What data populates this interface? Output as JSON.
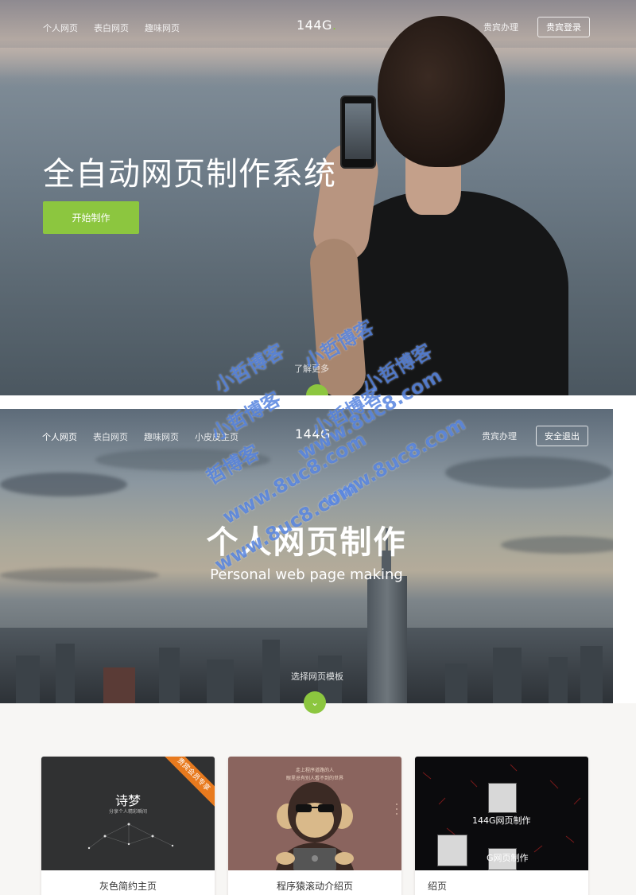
{
  "section1": {
    "nav": {
      "links": [
        "个人网页",
        "表白网页",
        "趣味网页"
      ],
      "brand": "144G",
      "brand_dot": ".",
      "vip": "贵宾办理",
      "login": "贵宾登录"
    },
    "title": "全自动网页制作系统",
    "cta": "开始制作",
    "learn_more": "了解更多",
    "scroll_icon": "chevron-down-icon"
  },
  "section2": {
    "nav": {
      "links": [
        "个人网页",
        "表白网页",
        "趣味网页",
        "小皮皮主页"
      ],
      "active_index": 0,
      "brand": "144G",
      "vip": "贵宾办理",
      "logout": "安全退出"
    },
    "title": "个人网页制作",
    "subtitle": "Personal web page making",
    "choose": "选择网页模板",
    "scroll_icon": "chevron-down-icon"
  },
  "templates": [
    {
      "label": "灰色简约主页",
      "ribbon": "贵宾会员专享",
      "thumb_title": "诗梦",
      "thumb_sub": "分享个人精彩瞬间"
    },
    {
      "label": "程序猿滚动介绍页",
      "thumb_line1": "走上程序道路的人",
      "thumb_line2": "眼里总有别人看不到的世界"
    },
    {
      "label": "绍页",
      "thumb_title": "144G网页制作",
      "thumb_overlay": "G网页制作"
    }
  ],
  "watermark": {
    "lines": [
      "小哲博客",
      "小哲博客",
      "小哲博客",
      "小哲博客",
      "小哲博客",
      "哲博客",
      "www.8uc8.com",
      "www.8uc8.com",
      "www.8uc8.com",
      "www.8uc8.com"
    ]
  },
  "colors": {
    "accent": "#8cc63f",
    "ribbon": "#e87a1e"
  }
}
